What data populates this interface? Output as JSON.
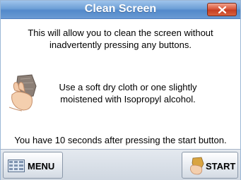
{
  "window": {
    "title": "Clean Screen",
    "close_icon": "close-x-icon"
  },
  "content": {
    "intro_line1": "This will allow you to clean the screen without",
    "intro_line2": "inadvertently pressing any buttons.",
    "cloth_line1": "Use a soft dry cloth or one slightly",
    "cloth_line2": "moistened with Isopropyl alcohol.",
    "countdown_text": "You have 10 seconds after pressing the start button.",
    "hand_icon": "hand-with-cloth-icon"
  },
  "footer": {
    "menu_label": "MENU",
    "menu_icon": "keypad-menu-icon",
    "start_label": "START",
    "start_icon": "hand-start-icon"
  },
  "colors": {
    "titlebar": "#6e9fd6",
    "close_button": "#d9583c",
    "footer_bar": "#cfd7e1"
  }
}
